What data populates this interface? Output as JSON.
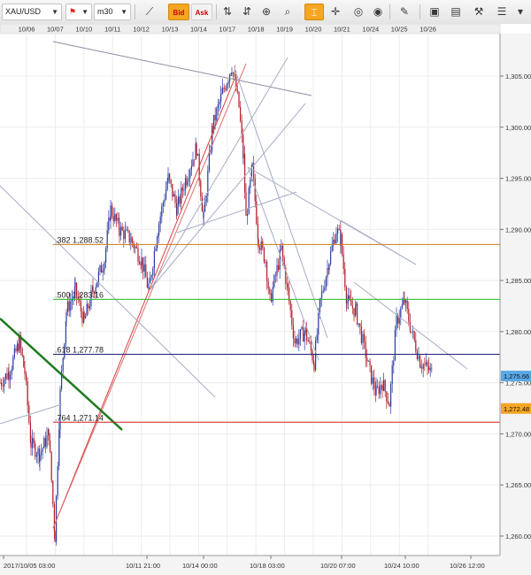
{
  "toolbar": {
    "symbol": "XAU/USD",
    "timeframe": "m30",
    "bid_label": "Bid",
    "ask_label": "Ask",
    "icons": [
      "flag-icon",
      "line-chart-icon",
      "tick-chart-icon",
      "candle-tick-icon",
      "zoom-in-icon",
      "zoom-out-icon",
      "magnifier-icon",
      "cursor-icon",
      "crosshair-icon",
      "globe-icon",
      "ruler-icon",
      "image-icon",
      "picture-icon",
      "tools-icon",
      "menu-icon",
      "more-icon"
    ],
    "colors": {
      "bid_bg": "#f5a623",
      "ask_bg": "#f0f0f0"
    }
  },
  "chart_data": {
    "type": "candlestick",
    "symbol": "XAU/USD",
    "timeframe": "m30",
    "ylim": [
      1258,
      1308
    ],
    "y_ticks": [
      "1,305.00",
      "1,300.00",
      "1,295.00",
      "1,290.00",
      "1,285.00",
      "1,280.00",
      "1,275.00",
      "1,270.00",
      "1,265.00",
      "1,260.00"
    ],
    "top_dates": [
      "10/06",
      "10/07",
      "10/10",
      "10/11",
      "10/12",
      "10/13",
      "10/14",
      "10/17",
      "10/18",
      "10/19",
      "10/20",
      "10/21",
      "10/24",
      "10/25",
      "10/26"
    ],
    "bottom_labels": [
      "2017/10/05 03:00",
      "10/11 21:00",
      "10/14 00:00",
      "10/18 03:00",
      "10/20 07:00",
      "10/24 10:00",
      "10/26 12:00"
    ],
    "price_path": [
      [
        0,
        1275
      ],
      [
        10,
        1276
      ],
      [
        22,
        1279
      ],
      [
        28,
        1276
      ],
      [
        35,
        1269
      ],
      [
        45,
        1268
      ],
      [
        55,
        1270
      ],
      [
        62,
        1260
      ],
      [
        68,
        1274
      ],
      [
        75,
        1282
      ],
      [
        85,
        1284
      ],
      [
        95,
        1281
      ],
      [
        105,
        1284
      ],
      [
        118,
        1287
      ],
      [
        125,
        1292
      ],
      [
        135,
        1290
      ],
      [
        148,
        1289
      ],
      [
        160,
        1287
      ],
      [
        168,
        1284
      ],
      [
        178,
        1290
      ],
      [
        190,
        1295
      ],
      [
        200,
        1292
      ],
      [
        210,
        1295
      ],
      [
        222,
        1298
      ],
      [
        230,
        1291
      ],
      [
        240,
        1300
      ],
      [
        250,
        1303
      ],
      [
        262,
        1306
      ],
      [
        270,
        1302
      ],
      [
        275,
        1297
      ],
      [
        278,
        1291
      ],
      [
        285,
        1296
      ],
      [
        292,
        1289
      ],
      [
        300,
        1287
      ],
      [
        305,
        1283
      ],
      [
        318,
        1288
      ],
      [
        325,
        1284
      ],
      [
        333,
        1279
      ],
      [
        345,
        1280
      ],
      [
        355,
        1277
      ],
      [
        362,
        1283
      ],
      [
        372,
        1287
      ],
      [
        380,
        1290
      ],
      [
        385,
        1289
      ],
      [
        392,
        1283
      ],
      [
        402,
        1282
      ],
      [
        410,
        1279
      ],
      [
        418,
        1276
      ],
      [
        425,
        1274
      ],
      [
        432,
        1275
      ],
      [
        440,
        1273
      ],
      [
        448,
        1281
      ],
      [
        457,
        1283
      ],
      [
        465,
        1280
      ],
      [
        475,
        1277
      ],
      [
        488,
        1276
      ]
    ],
    "fib_levels": [
      {
        "label": ".382 1,288.52",
        "value": 1288.52,
        "color": "#c87a1a"
      },
      {
        "label": ".500 1,283.16",
        "value": 1283.16,
        "color": "#22bb22"
      },
      {
        "label": ".618 1,277.78",
        "value": 1277.78,
        "color": "#1f1f7a"
      },
      {
        "label": ".764 1,271.14",
        "value": 1271.14,
        "color": "#d02020"
      }
    ],
    "price_tags": [
      {
        "label": "1,275.66",
        "value": 1275.66,
        "color": "#5aa9e6"
      },
      {
        "label": "1,272.48",
        "value": 1272.48,
        "color": "#f5a623"
      }
    ],
    "up_color": "#2b3c9e",
    "down_color": "#b31c2a"
  }
}
